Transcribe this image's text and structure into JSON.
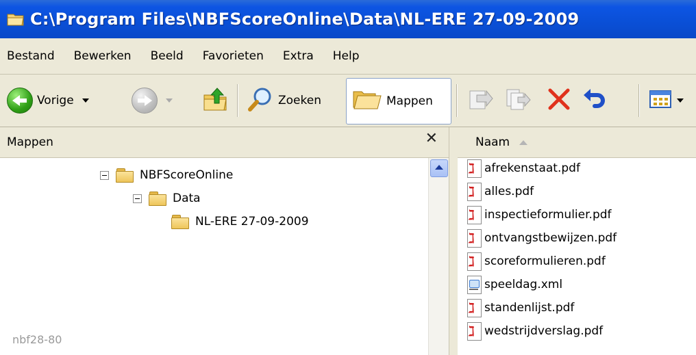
{
  "window": {
    "title": "C:\\Program Files\\NBFScoreOnline\\Data\\NL-ERE 27-09-2009"
  },
  "menu": [
    "Bestand",
    "Bewerken",
    "Beeld",
    "Favorieten",
    "Extra",
    "Help"
  ],
  "toolbar": {
    "back_label": "Vorige",
    "search_label": "Zoeken",
    "folders_label": "Mappen"
  },
  "folder_pane": {
    "header": "Mappen",
    "close": "✕",
    "tree": [
      {
        "label": "NBFScoreOnline",
        "expanded": true
      },
      {
        "label": "Data",
        "expanded": true
      },
      {
        "label": "NL-ERE 27-09-2009",
        "expanded": false
      }
    ],
    "watermark": "nbf28-80"
  },
  "file_list": {
    "column": "Naam",
    "files": [
      {
        "name": "afrekenstaat.pdf",
        "icon": "pdf-icon"
      },
      {
        "name": "alles.pdf",
        "icon": "pdf-icon"
      },
      {
        "name": "inspectieformulier.pdf",
        "icon": "pdf-icon"
      },
      {
        "name": "ontvangstbewijzen.pdf",
        "icon": "pdf-icon"
      },
      {
        "name": "scoreformulieren.pdf",
        "icon": "pdf-icon"
      },
      {
        "name": "speeldag.xml",
        "icon": "xml-icon"
      },
      {
        "name": "standenlijst.pdf",
        "icon": "pdf-icon"
      },
      {
        "name": "wedstrijdverslag.pdf",
        "icon": "pdf-icon"
      }
    ]
  },
  "colors": {
    "titlebar": "#0a4fd6",
    "chrome": "#ece9d8",
    "delete": "#e0321c",
    "undo": "#2050c8"
  }
}
